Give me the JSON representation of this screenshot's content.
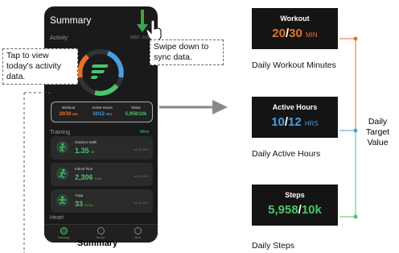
{
  "phone": {
    "title": "Summary",
    "activity_label": "Activity",
    "date": "WED, JUL",
    "stats": [
      {
        "label": "Workout",
        "value": "20/30",
        "unit": "MIN",
        "color": "#e8712b"
      },
      {
        "label": "Active Hours",
        "value": "10/12",
        "unit": "HRS",
        "color": "#4a9fe0"
      },
      {
        "label": "Steps",
        "value": "5,958/10k",
        "unit": "",
        "color": "#4ac56a"
      }
    ],
    "training_label": "Training",
    "more_label": "More",
    "activities": [
      {
        "name": "Outdoor Walk",
        "value": "1.35",
        "unit": "MI",
        "date": "Jul 13, 2021"
      },
      {
        "name": "Indoor Run",
        "value": "2,306",
        "unit": "Feet",
        "date": "Jul 13, 2021"
      },
      {
        "name": "Yoga",
        "value": "33",
        "unit": "KCAL",
        "date": "Jul 13, 2021"
      }
    ],
    "heart_label": "Heart",
    "tabs": [
      "Summary",
      "Device",
      "Mine"
    ]
  },
  "callouts": {
    "tap": "Tap to view today's activity data.",
    "swipe": "Swipe down to sync data."
  },
  "caption": "Summary",
  "panels": {
    "workout": {
      "title": "Workout",
      "current": "20",
      "target": "30",
      "unit": "MIN",
      "caption": "Daily Workout Minutes",
      "color": "#e8712b"
    },
    "active": {
      "title": "Active Hours",
      "current": "10",
      "target": "12",
      "unit": "HRS",
      "caption": "Daily Active Hours",
      "color": "#4a9fe0"
    },
    "steps": {
      "title": "Steps",
      "current": "5,958",
      "target": "10k",
      "unit": "",
      "caption": "Daily Steps",
      "color": "#4ac56a"
    }
  },
  "target_label": "Daily Target Value"
}
